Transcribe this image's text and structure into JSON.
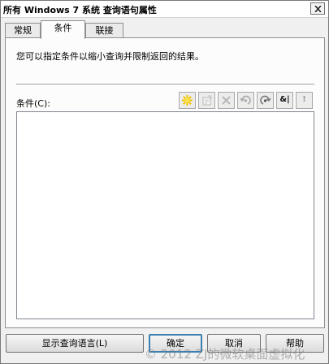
{
  "window": {
    "title": "所有 Windows 7 系统 查询语句属性"
  },
  "tabs": [
    {
      "label": "常规",
      "active": false
    },
    {
      "label": "条件",
      "active": true
    },
    {
      "label": "联接",
      "active": false
    }
  ],
  "panel": {
    "description": "您可以指定条件以缩小查询并限制返回的结果。",
    "conditions_label": "条件(C):"
  },
  "toolbar": {
    "and_label": "&|",
    "not_label": "!",
    "icons": [
      "new-condition-icon",
      "properties-icon",
      "delete-icon",
      "undo-icon",
      "redo-icon",
      "and-or-icon",
      "not-icon"
    ]
  },
  "buttons": {
    "show_query": "显示查询语言(L)",
    "ok": "确定",
    "cancel": "取消",
    "help": "帮助"
  },
  "watermark": "© 2012 ZJ的微软桌面虚拟化"
}
